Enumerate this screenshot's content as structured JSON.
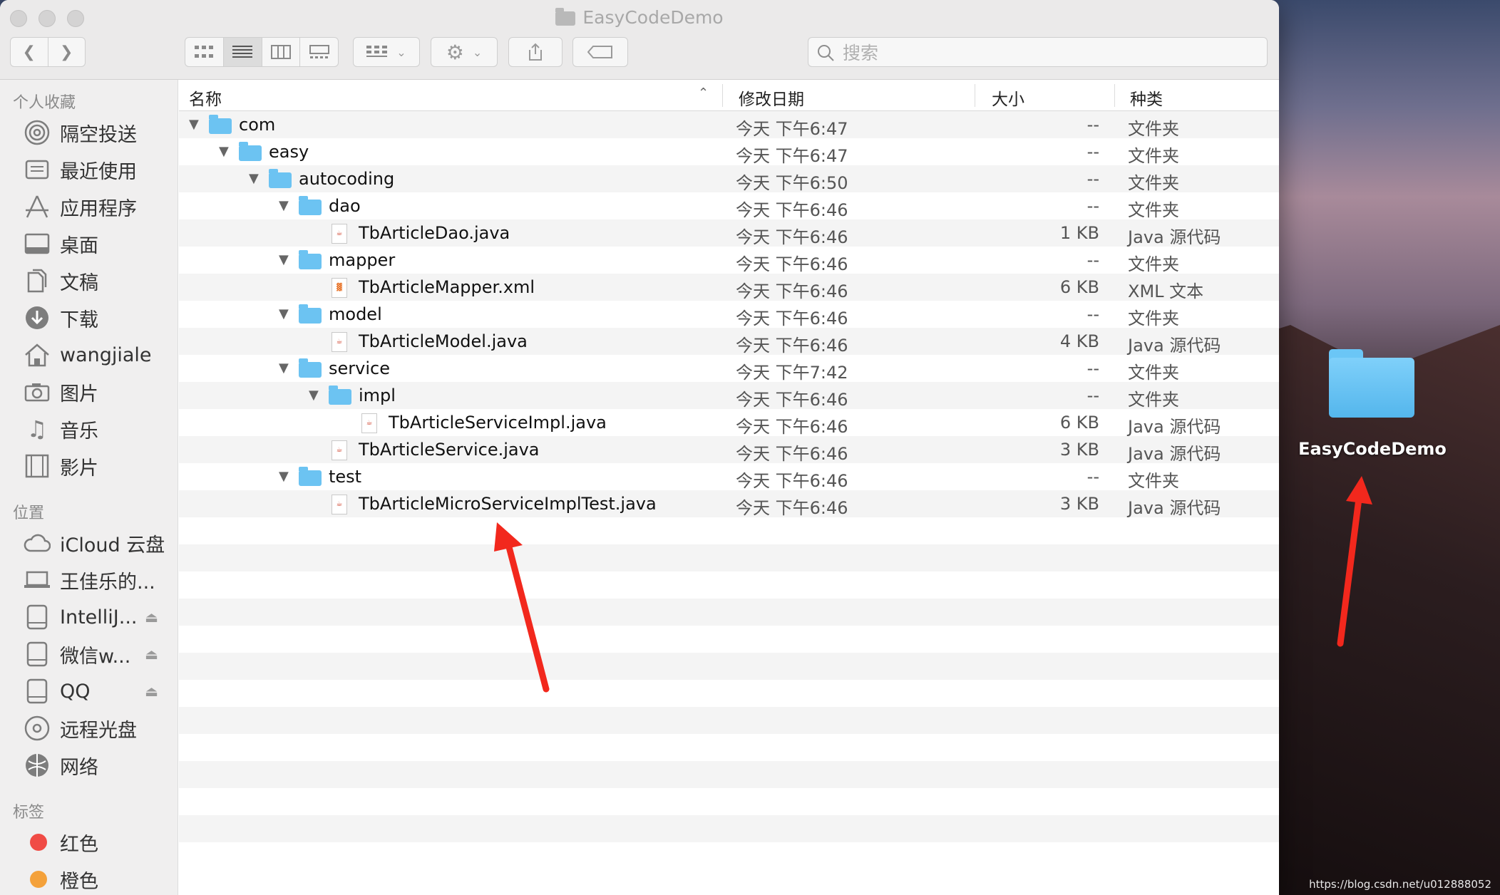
{
  "window": {
    "title": "EasyCodeDemo"
  },
  "toolbar": {
    "back_icon": "chevron-left-icon",
    "forward_icon": "chevron-right-icon",
    "search_placeholder": "搜索"
  },
  "sidebar": {
    "favorites_title": "个人收藏",
    "favorites": [
      {
        "label": "隔空投送",
        "icon": "airdrop-icon"
      },
      {
        "label": "最近使用",
        "icon": "recents-icon"
      },
      {
        "label": "应用程序",
        "icon": "applications-icon"
      },
      {
        "label": "桌面",
        "icon": "desktop-icon"
      },
      {
        "label": "文稿",
        "icon": "documents-icon"
      },
      {
        "label": "下载",
        "icon": "downloads-icon"
      },
      {
        "label": "wangjiale",
        "icon": "home-icon"
      },
      {
        "label": "图片",
        "icon": "pictures-icon"
      },
      {
        "label": "音乐",
        "icon": "music-icon"
      },
      {
        "label": "影片",
        "icon": "movies-icon"
      }
    ],
    "locations_title": "位置",
    "locations": [
      {
        "label": "iCloud 云盘",
        "icon": "cloud-icon"
      },
      {
        "label": "王佳乐的...",
        "icon": "laptop-icon"
      },
      {
        "label": "IntelliJ...",
        "icon": "disk-icon"
      },
      {
        "label": "微信w...",
        "icon": "disk-icon"
      },
      {
        "label": "QQ",
        "icon": "disk-icon"
      },
      {
        "label": "远程光盘",
        "icon": "optical-disc-icon"
      },
      {
        "label": "网络",
        "icon": "network-icon"
      }
    ],
    "tags_title": "标签",
    "tags": [
      {
        "label": "红色",
        "color": "#f04b45"
      },
      {
        "label": "橙色",
        "color": "#f4a13a"
      }
    ]
  },
  "columns": {
    "name": "名称",
    "date": "修改日期",
    "size": "大小",
    "kind": "种类"
  },
  "files": [
    {
      "name": "com",
      "type": "folder",
      "level": 0,
      "expanded": true,
      "date": "今天 下午6:47",
      "size": "--",
      "kind": "文件夹"
    },
    {
      "name": "easy",
      "type": "folder",
      "level": 1,
      "expanded": true,
      "date": "今天 下午6:47",
      "size": "--",
      "kind": "文件夹"
    },
    {
      "name": "autocoding",
      "type": "folder",
      "level": 2,
      "expanded": true,
      "date": "今天 下午6:50",
      "size": "--",
      "kind": "文件夹"
    },
    {
      "name": "dao",
      "type": "folder",
      "level": 3,
      "expanded": true,
      "date": "今天 下午6:46",
      "size": "--",
      "kind": "文件夹"
    },
    {
      "name": "TbArticleDao.java",
      "type": "java",
      "level": 4,
      "expanded": false,
      "date": "今天 下午6:46",
      "size": "1 KB",
      "kind": "Java 源代码"
    },
    {
      "name": "mapper",
      "type": "folder",
      "level": 3,
      "expanded": true,
      "date": "今天 下午6:46",
      "size": "--",
      "kind": "文件夹"
    },
    {
      "name": "TbArticleMapper.xml",
      "type": "xml",
      "level": 4,
      "expanded": false,
      "date": "今天 下午6:46",
      "size": "6 KB",
      "kind": "XML 文本"
    },
    {
      "name": "model",
      "type": "folder",
      "level": 3,
      "expanded": true,
      "date": "今天 下午6:46",
      "size": "--",
      "kind": "文件夹"
    },
    {
      "name": "TbArticleModel.java",
      "type": "java",
      "level": 4,
      "expanded": false,
      "date": "今天 下午6:46",
      "size": "4 KB",
      "kind": "Java 源代码"
    },
    {
      "name": "service",
      "type": "folder",
      "level": 3,
      "expanded": true,
      "date": "今天 下午7:42",
      "size": "--",
      "kind": "文件夹"
    },
    {
      "name": "impl",
      "type": "folder",
      "level": 4,
      "expanded": true,
      "date": "今天 下午6:46",
      "size": "--",
      "kind": "文件夹"
    },
    {
      "name": "TbArticleServiceImpl.java",
      "type": "java",
      "level": 5,
      "expanded": false,
      "date": "今天 下午6:46",
      "size": "6 KB",
      "kind": "Java 源代码"
    },
    {
      "name": "TbArticleService.java",
      "type": "java",
      "level": 4,
      "expanded": false,
      "date": "今天 下午6:46",
      "size": "3 KB",
      "kind": "Java 源代码"
    },
    {
      "name": "test",
      "type": "folder",
      "level": 3,
      "expanded": true,
      "date": "今天 下午6:46",
      "size": "--",
      "kind": "文件夹"
    },
    {
      "name": "TbArticleMicroServiceImplTest.java",
      "type": "java",
      "level": 4,
      "expanded": false,
      "date": "今天 下午6:46",
      "size": "3 KB",
      "kind": "Java 源代码"
    }
  ],
  "desktop": {
    "folder_label": "EasyCodeDemo"
  },
  "watermark": "https://blog.csdn.net/u012888052"
}
